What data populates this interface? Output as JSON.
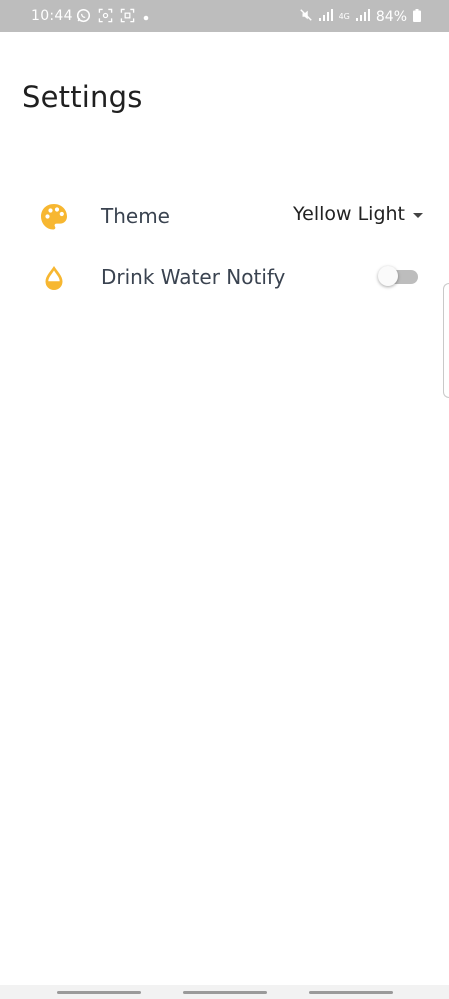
{
  "status_bar": {
    "time": "10:44",
    "battery": "84%",
    "network": "4G"
  },
  "header": {
    "title": "Settings"
  },
  "settings": {
    "theme": {
      "label": "Theme",
      "value": "Yellow Light",
      "icon": "palette-icon"
    },
    "drink_water": {
      "label": "Drink Water Notify",
      "enabled": false,
      "icon": "water-drop-icon"
    }
  },
  "colors": {
    "accent": "#f7b731",
    "text_primary": "#1f1f1f",
    "text_label": "#3a4350",
    "status_bar_bg": "#bdbdbd"
  }
}
